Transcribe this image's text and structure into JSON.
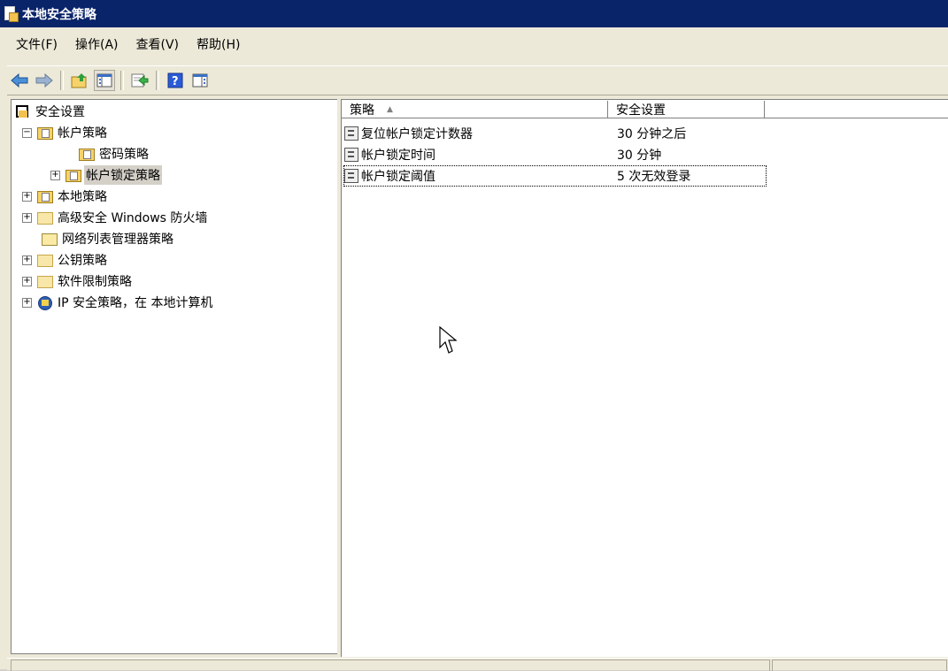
{
  "window": {
    "title": "本地安全策略"
  },
  "menu": [
    {
      "label": "文件(F)"
    },
    {
      "label": "操作(A)"
    },
    {
      "label": "查看(V)"
    },
    {
      "label": "帮助(H)"
    }
  ],
  "toolbar": {
    "buttons": [
      "back-arrow-icon",
      "forward-arrow-icon",
      "up-folder-icon",
      "show-hide-tree-icon",
      "export-list-icon",
      "help-icon",
      "properties-icon"
    ]
  },
  "tree": {
    "root": "安全设置",
    "account_policies": "帐户策略",
    "password_policy": "密码策略",
    "account_lockout_policy": "帐户锁定策略",
    "local_policies": "本地策略",
    "firewall": "高级安全 Windows 防火墙",
    "network_list": "网络列表管理器策略",
    "public_key": "公钥策略",
    "software_restriction": "软件限制策略",
    "ipsec": "IP 安全策略，在 本地计算机",
    "expander_collapsed": "+",
    "expander_expanded": "−"
  },
  "list": {
    "columns": {
      "policy": "策略",
      "setting": "安全设置",
      "sort_indicator": "▲"
    },
    "rows": [
      {
        "name": "复位帐户锁定计数器",
        "value": "30 分钟之后"
      },
      {
        "name": "帐户锁定时间",
        "value": "30 分钟"
      },
      {
        "name": "帐户锁定阈值",
        "value": "5 次无效登录"
      }
    ]
  }
}
